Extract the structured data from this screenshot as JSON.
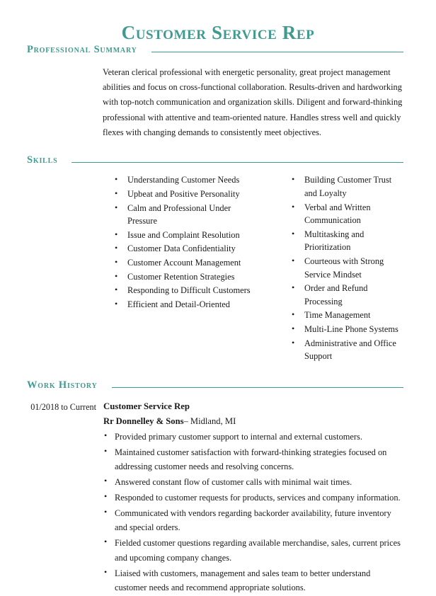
{
  "document": {
    "title": "Customer Service Rep"
  },
  "theme": {
    "accent": "#3f9a90",
    "text": "#1a1a1a",
    "background": "#ffffff"
  },
  "sections": {
    "summary": {
      "heading": "Professional Summary",
      "text": "Veteran clerical professional with energetic personality, great project management abilities and focus on cross-functional collaboration. Results-driven and hardworking with top-notch communication and organization skills. Diligent and forward-thinking professional with attentive and team-oriented nature. Handles stress well and quickly flexes with changing demands to consistently meet objectives."
    },
    "skills": {
      "heading": "Skills",
      "left_column": [
        "Understanding Customer Needs",
        "Upbeat and Positive Personality",
        "Calm and Professional Under Pressure",
        "Issue and Complaint Resolution",
        "Customer Data Confidentiality",
        "Customer Account Management",
        "Customer Retention Strategies",
        "Responding to Difficult Customers",
        "Efficient and Detail-Oriented"
      ],
      "right_column": [
        "Building Customer Trust and Loyalty",
        "Verbal and Written Communication",
        "Multitasking and Prioritization",
        "Courteous with Strong Service Mindset",
        "Order and Refund Processing",
        "Time Management",
        "Multi-Line Phone Systems",
        "Administrative and Office Support"
      ]
    },
    "work_history": {
      "heading": "Work History",
      "jobs": [
        {
          "date_range": "01/2018 to Current",
          "title": "Customer Service Rep",
          "company": "Rr Donnelley & Sons",
          "location": "– Midland, MI",
          "bullets": [
            "Provided primary customer support to internal and external customers.",
            "Maintained customer satisfaction with forward-thinking strategies focused on addressing customer needs and resolving concerns.",
            "Answered constant flow of customer calls with minimal wait times.",
            "Responded to customer requests for products, services and company information.",
            "Communicated with vendors regarding backorder availability, future inventory and special orders.",
            "Fielded customer questions regarding available merchandise, sales, current prices and upcoming company changes.",
            "Liaised with customers, management and sales team to better understand customer needs and recommend appropriate solutions."
          ]
        }
      ]
    }
  }
}
